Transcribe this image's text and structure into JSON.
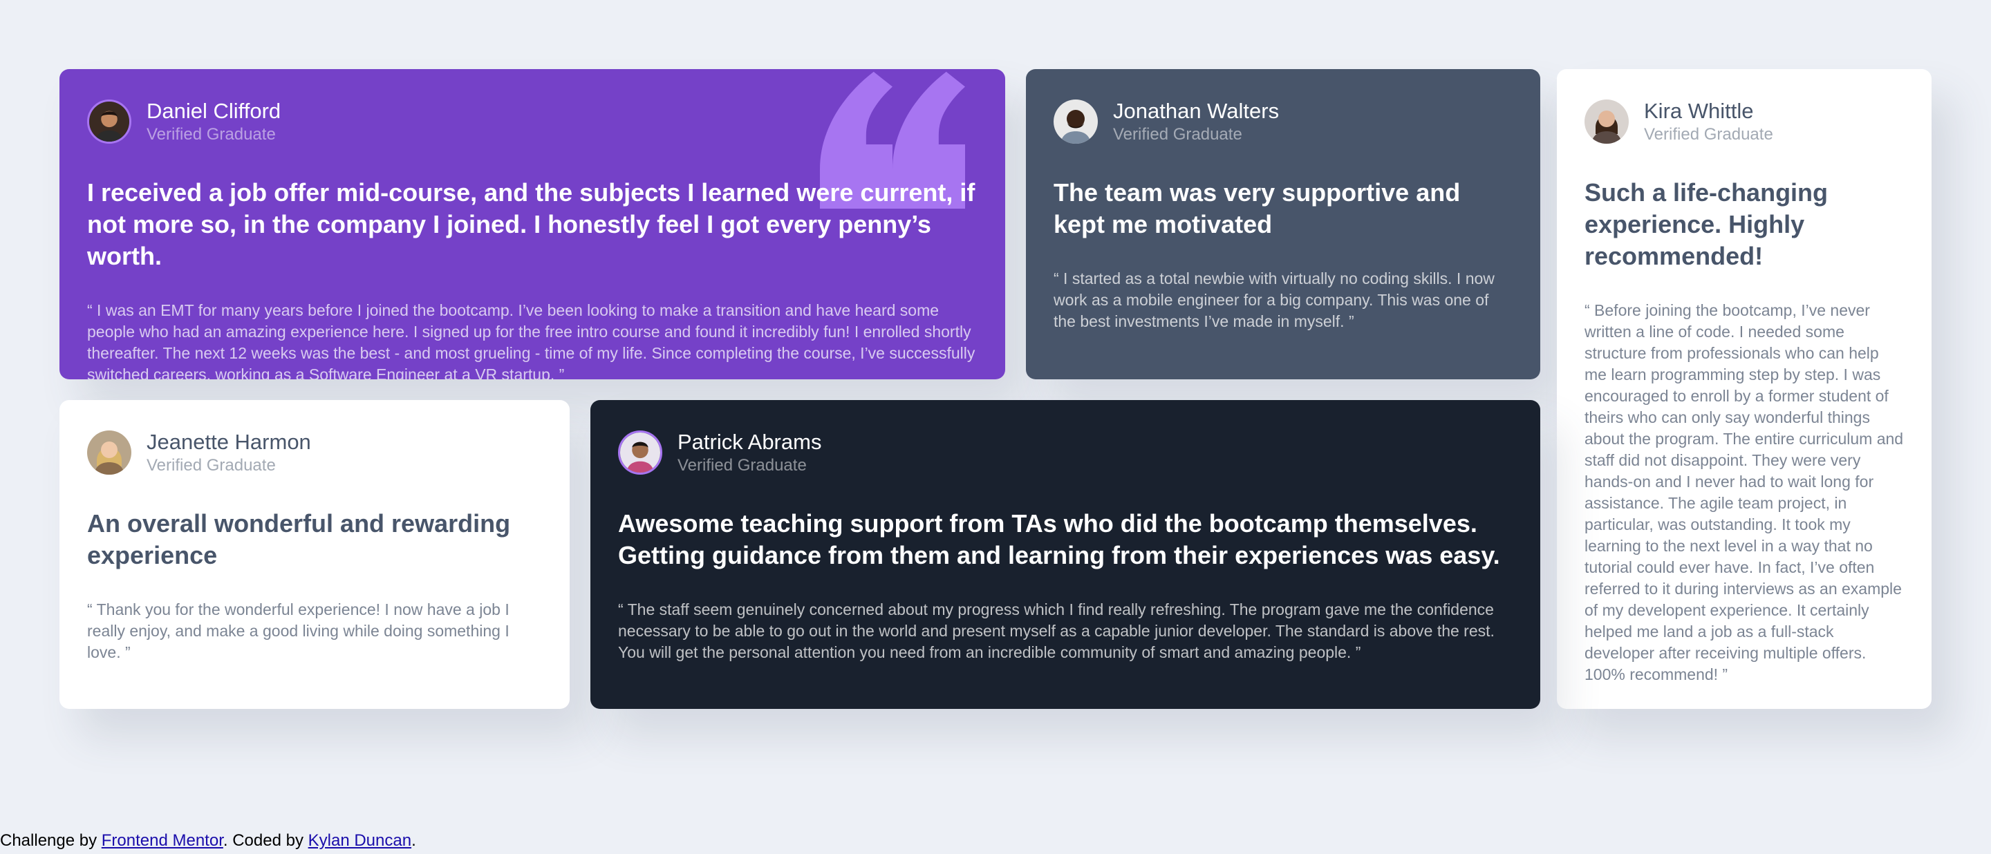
{
  "testimonials": [
    {
      "name": "Daniel Clifford",
      "role": "Verified Graduate",
      "headline": "I received a job offer mid-course, and the subjects I learned were current, if not more so, in the company I joined. I honestly feel I got every penny’s worth.",
      "body": "“ I was an EMT for many years before I joined the bootcamp. I’ve been looking to make a transition and have heard some people who had an amazing experience here. I signed up for the free intro course and found it incredibly fun! I enrolled shortly thereafter. The next 12 weeks was the best - and most grueling - time of my life. Since completing the course, I’ve successfully switched careers, working as a Software Engineer at a VR startup. ”"
    },
    {
      "name": "Jonathan Walters",
      "role": "Verified Graduate",
      "headline": "The team was very supportive and kept me motivated",
      "body": "“ I started as a total newbie with virtually no coding skills. I now work as a mobile engineer for a big company. This was one of the best investments I’ve made in myself. ”"
    },
    {
      "name": "Kira Whittle",
      "role": "Verified Graduate",
      "headline": "Such a life-changing experience. Highly recommended!",
      "body": "“ Before joining the bootcamp, I’ve never written a line of code. I needed some structure from professionals who can help me learn programming step by step. I was encouraged to enroll by a former student of theirs who can only say wonderful things about the program. The entire curriculum and staff did not disappoint. They were very hands-on and I never had to wait long for assistance. The agile team project, in particular, was outstanding. It took my learning to the next level in a way that no tutorial could ever have. In fact, I’ve often referred to it during interviews as an example of my developent experience. It certainly helped me land a job as a full-stack developer after receiving multiple offers. 100% recommend! ”"
    },
    {
      "name": "Jeanette Harmon",
      "role": "Verified Graduate",
      "headline": "An overall wonderful and rewarding experience",
      "body": "“ Thank you for the wonderful experience! I now have a job I really enjoy, and make a good living while doing something I love. ”"
    },
    {
      "name": "Patrick Abrams",
      "role": "Verified Graduate",
      "headline": "Awesome teaching support from TAs who did the bootcamp themselves. Getting guidance from them and learning from their experiences was easy.",
      "body": "“ The staff seem genuinely concerned about my progress which I find really refreshing. The program gave me the confidence necessary to be able to go out in the world and present myself as a capable junior developer. The standard is above the rest. You will get the personal attention you need from an incredible community of smart and amazing people. ”"
    }
  ],
  "footer": {
    "prefix": "Challenge by ",
    "link1": "Frontend Mentor",
    "middle": ". Coded by ",
    "link2": "Kylan Duncan",
    "suffix": "."
  },
  "colors": {
    "page_bg": "#edf0f6",
    "purple": "#7541c8",
    "slate": "#48556a",
    "white": "#ffffff",
    "dark": "#19212e",
    "quote_mark": "#a775f1"
  },
  "icons": {
    "quote": "quotation-mark-icon"
  }
}
